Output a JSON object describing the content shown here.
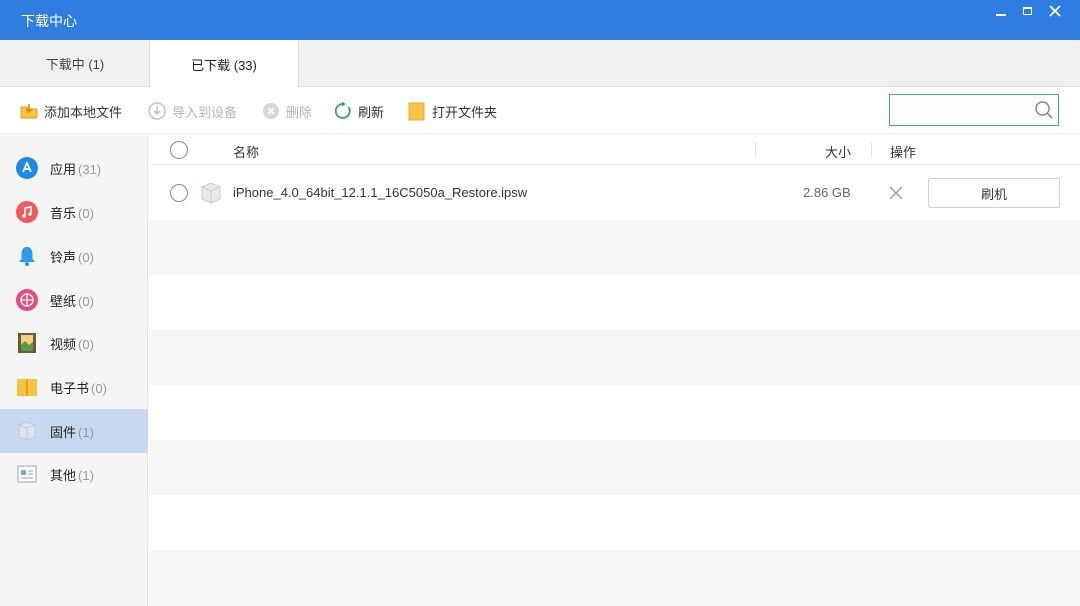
{
  "window": {
    "title": "下载中心"
  },
  "tabs": [
    {
      "label": "下载中 (1)",
      "active": false
    },
    {
      "label": "已下载 (33)",
      "active": true
    }
  ],
  "toolbar": {
    "add_local": "添加本地文件",
    "import_device": "导入到设备",
    "delete": "删除",
    "refresh": "刷新",
    "open_folder": "打开文件夹",
    "search_value": "",
    "search_placeholder": ""
  },
  "sidebar": {
    "items": [
      {
        "label": "应用",
        "count": "(31)",
        "icon": "app-store-icon",
        "active": false
      },
      {
        "label": "音乐",
        "count": "(0)",
        "icon": "music-icon",
        "active": false
      },
      {
        "label": "铃声",
        "count": "(0)",
        "icon": "bell-icon",
        "active": false
      },
      {
        "label": "壁纸",
        "count": "(0)",
        "icon": "wallpaper-icon",
        "active": false
      },
      {
        "label": "视频",
        "count": "(0)",
        "icon": "video-icon",
        "active": false
      },
      {
        "label": "电子书",
        "count": "(0)",
        "icon": "book-icon",
        "active": false
      },
      {
        "label": "固件",
        "count": "(1)",
        "icon": "firmware-icon",
        "active": true
      },
      {
        "label": "其他",
        "count": "(1)",
        "icon": "other-file-icon",
        "active": false
      }
    ]
  },
  "list": {
    "headers": {
      "name": "名称",
      "size": "大小",
      "action": "操作"
    },
    "rows": [
      {
        "name": "iPhone_4.0_64bit_12.1.1_16C5050a_Restore.ipsw",
        "size": "2.86 GB",
        "action_label": "刷机"
      }
    ]
  },
  "colors": {
    "titlebar": "#2f7de1",
    "active_sidebar": "#c8d8f0",
    "search_border": "#3cb371"
  }
}
